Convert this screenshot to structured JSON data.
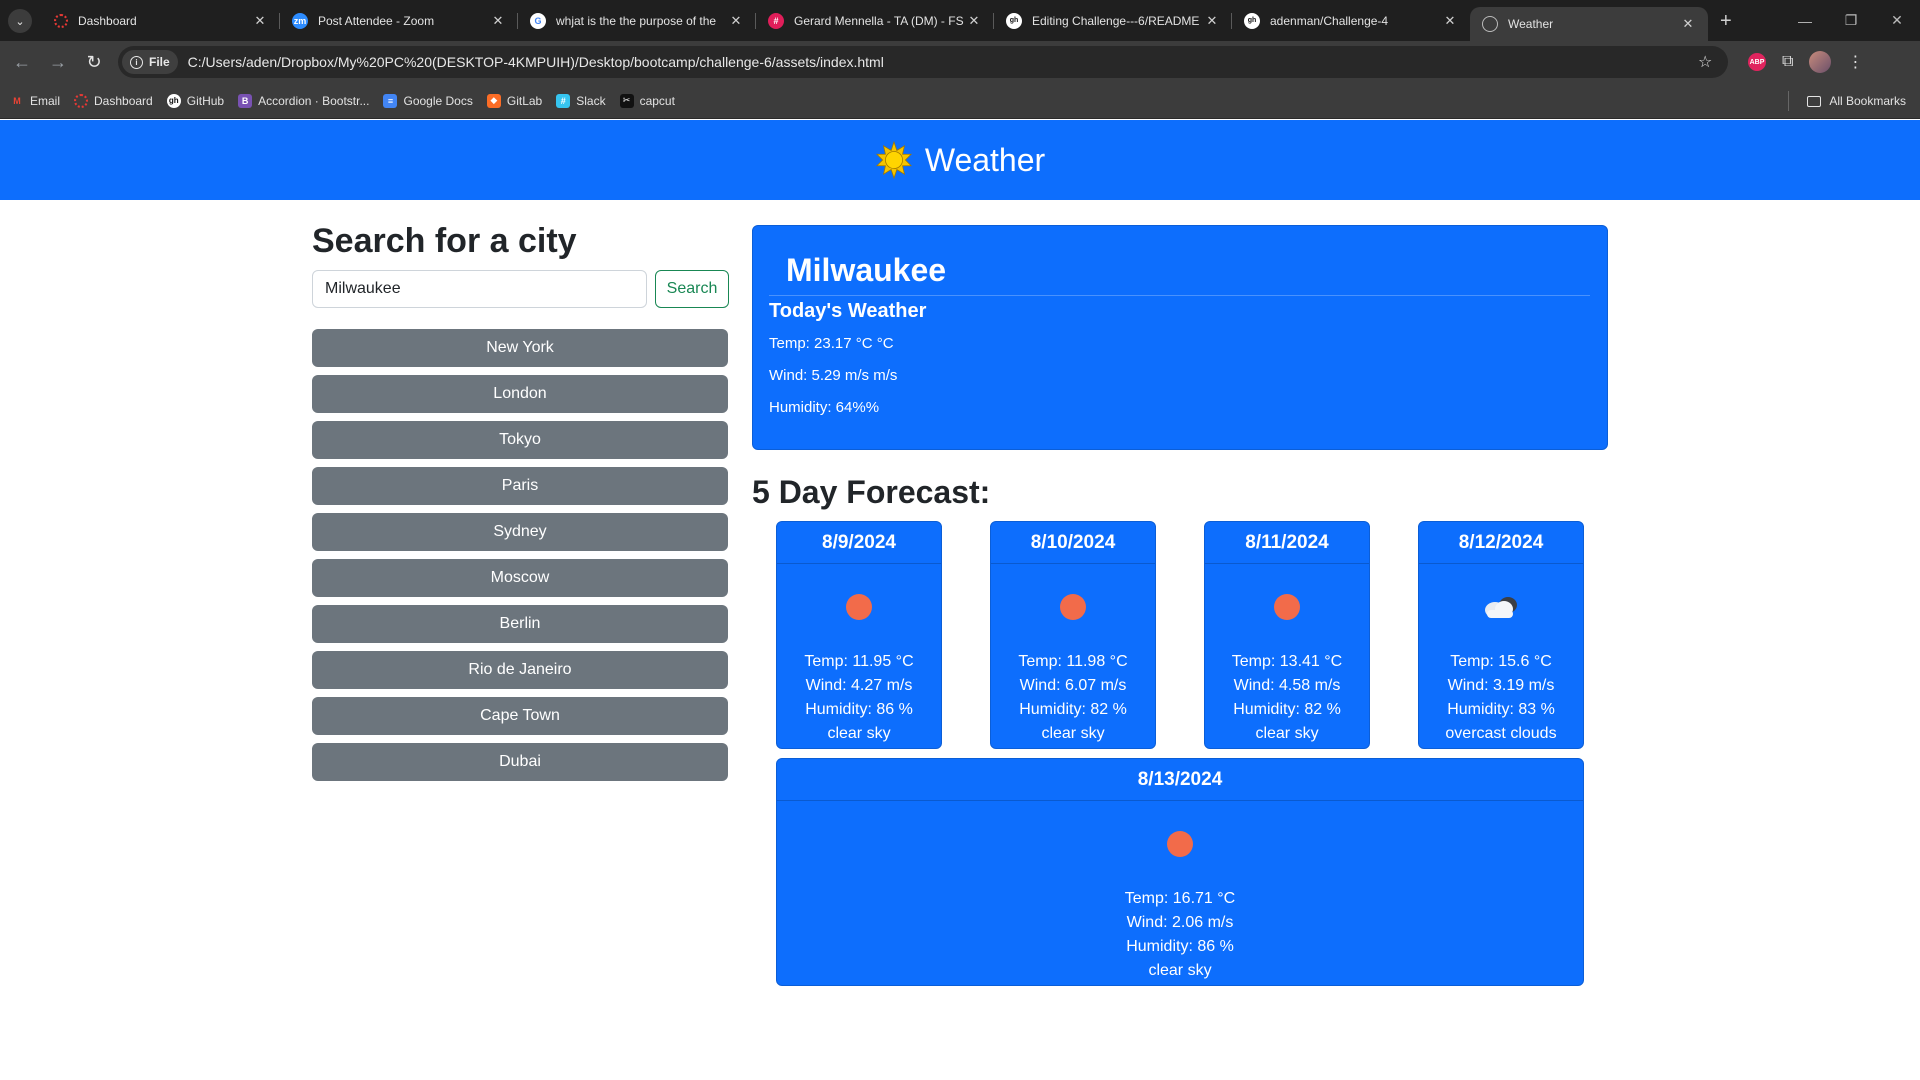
{
  "browser": {
    "tabs": [
      {
        "title": "Dashboard",
        "fav_color": "#e53935",
        "fav_text": ""
      },
      {
        "title": "Post Attendee - Zoom",
        "fav_color": "#2d8cff",
        "fav_text": "zm"
      },
      {
        "title": "whjat is the the purpose of the",
        "fav_color": "#ffffff",
        "fav_text": "G"
      },
      {
        "title": "Gerard Mennella - TA (DM) - FS",
        "fav_color": "#e01e5a",
        "fav_text": "#"
      },
      {
        "title": "Editing Challenge---6/README",
        "fav_color": "#ffffff",
        "fav_text": "gh"
      },
      {
        "title": "adenman/Challenge-4",
        "fav_color": "#ffffff",
        "fav_text": "gh"
      },
      {
        "title": "Weather",
        "fav_color": "#9aa0a6",
        "fav_text": ""
      }
    ],
    "address": {
      "chip_label": "File",
      "url": "C:/Users/aden/Dropbox/My%20PC%20(DESKTOP-4KMPUIH)/Desktop/bootcamp/challenge-6/assets/index.html"
    },
    "bookmarks": [
      {
        "label": "Email",
        "color": "#ea4335",
        "glyph": "M"
      },
      {
        "label": "Dashboard",
        "color": "#e53935",
        "glyph": "◌"
      },
      {
        "label": "GitHub",
        "color": "#444444",
        "glyph": "◉"
      },
      {
        "label": "Accordion · Bootstr...",
        "color": "#7952b3",
        "glyph": "B"
      },
      {
        "label": "Google Docs",
        "color": "#4285f4",
        "glyph": "≡"
      },
      {
        "label": "GitLab",
        "color": "#fc6d26",
        "glyph": "◆"
      },
      {
        "label": "Slack",
        "color": "#36c5f0",
        "glyph": "#"
      },
      {
        "label": "capcut",
        "color": "#111111",
        "glyph": "✂"
      }
    ],
    "all_bookmarks_label": "All Bookmarks"
  },
  "header": {
    "title": "Weather"
  },
  "search": {
    "heading": "Search for a city",
    "input_value": "Milwaukee",
    "button_label": "Search"
  },
  "cities": [
    "New York",
    "London",
    "Tokyo",
    "Paris",
    "Sydney",
    "Moscow",
    "Berlin",
    "Rio de Janeiro",
    "Cape Town",
    "Dubai"
  ],
  "today": {
    "city": "Milwaukee",
    "subtitle": "Today's Weather",
    "temp": "Temp: 23.17 °C °C",
    "wind": "Wind: 5.29 m/s m/s",
    "humidity": "Humidity: 64%%"
  },
  "forecast": {
    "title": "5 Day Forecast:",
    "days": [
      {
        "date": "8/9/2024",
        "icon": "sun-dot-icon",
        "temp": "Temp: 11.95 °C",
        "wind": "Wind: 4.27 m/s",
        "humidity": "Humidity: 86 %",
        "desc": "clear sky"
      },
      {
        "date": "8/10/2024",
        "icon": "sun-dot-icon",
        "temp": "Temp: 11.98 °C",
        "wind": "Wind: 6.07 m/s",
        "humidity": "Humidity: 82 %",
        "desc": "clear sky"
      },
      {
        "date": "8/11/2024",
        "icon": "sun-dot-icon",
        "temp": "Temp: 13.41 °C",
        "wind": "Wind: 4.58 m/s",
        "humidity": "Humidity: 82 %",
        "desc": "clear sky"
      },
      {
        "date": "8/12/2024",
        "icon": "cloud-icon",
        "temp": "Temp: 15.6 °C",
        "wind": "Wind: 3.19 m/s",
        "humidity": "Humidity: 83 %",
        "desc": "overcast clouds"
      },
      {
        "date": "8/13/2024",
        "icon": "sun-dot-icon",
        "temp": "Temp: 16.71 °C",
        "wind": "Wind: 2.06 m/s",
        "humidity": "Humidity: 86 %",
        "desc": "clear sky"
      }
    ]
  },
  "colors": {
    "primary": "#0d6efd",
    "secondary": "#6c757d",
    "success": "#198754",
    "sun_dot": "#f26b4a"
  }
}
